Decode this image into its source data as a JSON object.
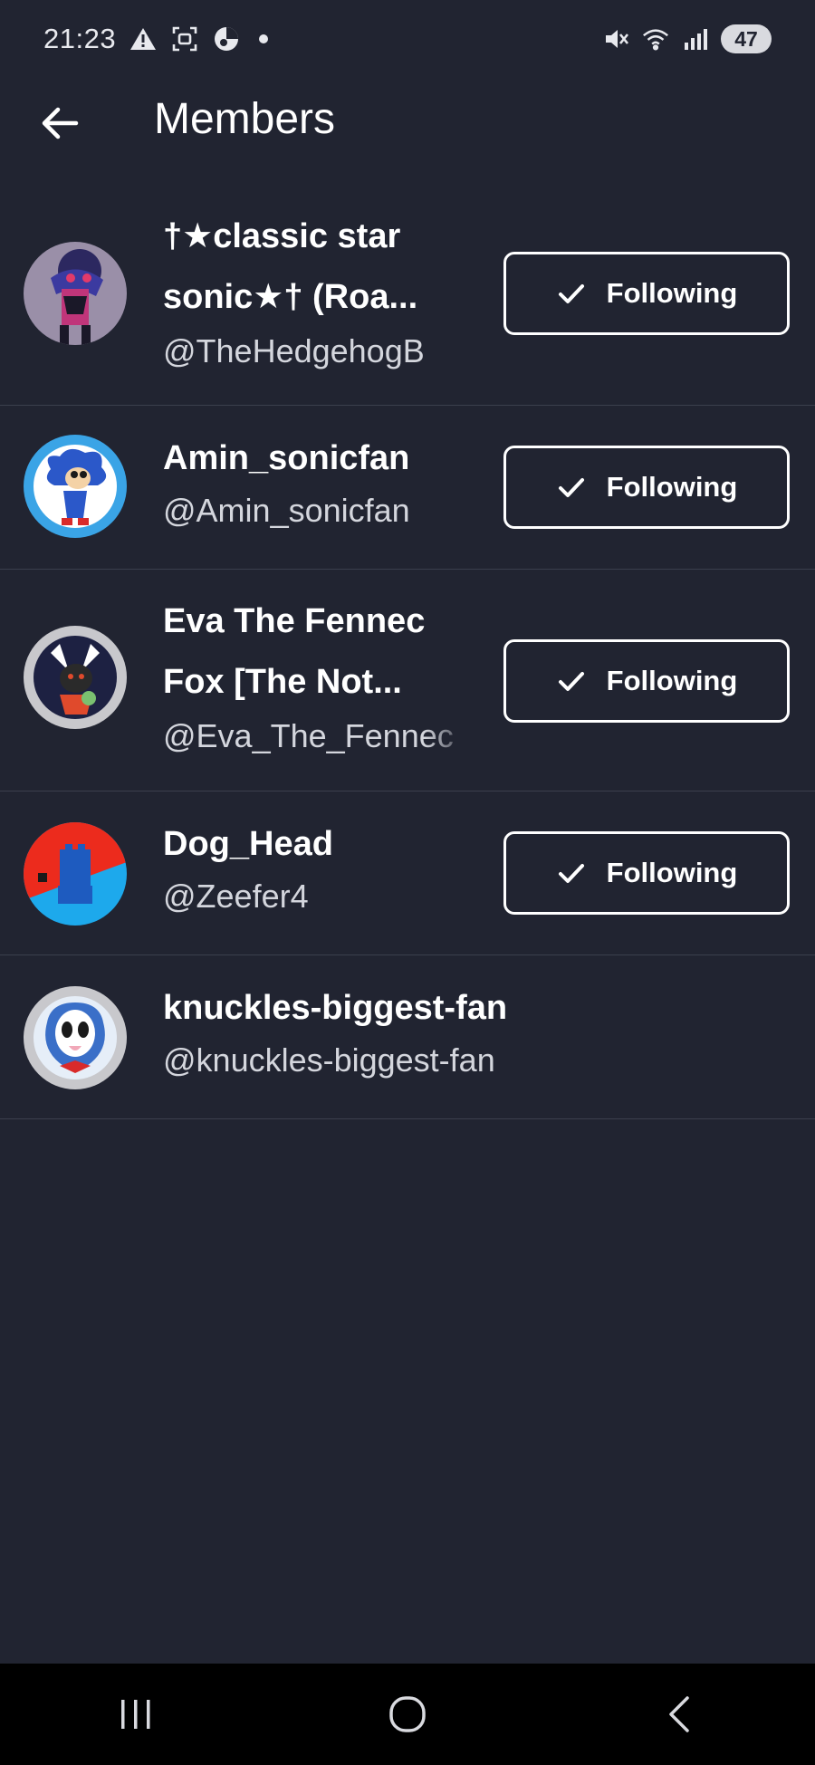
{
  "status_bar": {
    "time": "21:23",
    "icons_left": [
      "warning-icon",
      "screenshot-icon",
      "music-app-icon",
      "notification-dot"
    ],
    "icons_right": [
      "mute-icon",
      "wifi-icon",
      "signal-icon"
    ],
    "battery": "47"
  },
  "header": {
    "title": "Members",
    "back_icon": "arrow-left-icon"
  },
  "members": [
    {
      "name": "†★classic star sonic★† (Roa...",
      "handle": "@TheHedgehogB",
      "follow_label": "Following",
      "following": true,
      "avatar_colors": [
        "#9a8fa8",
        "#c0357a",
        "#2c2860"
      ]
    },
    {
      "name": "Amin_sonicfan",
      "handle": "@Amin_sonicfan",
      "follow_label": "Following",
      "following": true,
      "avatar_colors": [
        "#3aa4e6",
        "#ffffff",
        "#2b58c9"
      ]
    },
    {
      "name": "Eva The Fennec Fox [The Not...",
      "handle": "@Eva_The_Fennec",
      "follow_label": "Following",
      "following": true,
      "avatar_colors": [
        "#1d2142",
        "#c8c8cc",
        "#e04a2c"
      ]
    },
    {
      "name": "Dog_Head",
      "handle": "@Zeefer4",
      "follow_label": "Following",
      "following": true,
      "avatar_colors": [
        "#ec2b1d",
        "#1da9ec",
        "#1e5bbf"
      ]
    },
    {
      "name": "knuckles-biggest-fan",
      "handle": "@knuckles-biggest-fan",
      "follow_label": "",
      "following": false,
      "avatar_colors": [
        "#e6eef8",
        "#3a6fc8",
        "#d92a2a"
      ]
    }
  ],
  "nav_bar": {
    "items": [
      "recents-icon",
      "home-icon",
      "back-icon"
    ]
  },
  "colors": {
    "background": "#212431",
    "divider": "#3b3f4d",
    "text_primary": "#ffffff",
    "text_secondary": "#d4d6dd"
  }
}
